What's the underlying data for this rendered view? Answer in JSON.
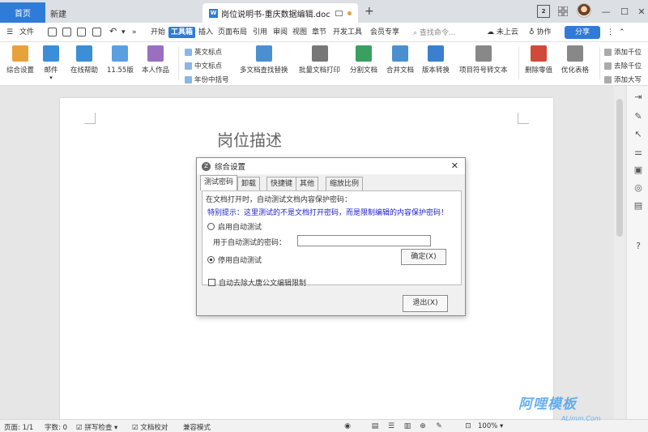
{
  "titlebar": {
    "tabs": [
      {
        "label": "首页"
      },
      {
        "label": "新建"
      },
      {
        "label": "岗位说明书-重庆数据编辑.doc"
      }
    ],
    "box_label": "2"
  },
  "menubar": {
    "file": "文件",
    "items": [
      "开始",
      "工具箱",
      "插入",
      "页面布局",
      "引用",
      "审阅",
      "视图",
      "章节",
      "开发工具",
      "会员专享"
    ],
    "search_placeholder": "查找命令...",
    "cloud": "未上云",
    "collab": "协作",
    "share": "分享"
  },
  "ribbon": {
    "buttons": [
      {
        "label": "综合设置",
        "color": "#e8a23a"
      },
      {
        "label": "邮件",
        "color": "#3a8fd8"
      },
      {
        "label": "在线帮助",
        "color": "#3a8fd8"
      },
      {
        "label": "11.55版",
        "color": "#5aa0e0"
      },
      {
        "label": "本人作品",
        "color": "#9a6fc0"
      }
    ],
    "small_left": [
      "英文标点",
      "中文标点",
      "年份中括号"
    ],
    "buttons2": [
      {
        "label": "多文档查找替换",
        "color": "#4a90d0"
      },
      {
        "label": "批量文档打印",
        "color": "#777777"
      },
      {
        "label": "分割文档",
        "color": "#3aa060"
      },
      {
        "label": "合并文档",
        "color": "#4a90d0"
      },
      {
        "label": "版本转换",
        "color": "#3a7fd0"
      },
      {
        "label": "项目符号转文本",
        "color": "#888888"
      },
      {
        "label": "删除零值",
        "color": "#d04a3a"
      },
      {
        "label": "优化表格",
        "color": "#888888"
      }
    ],
    "small_right": [
      "添加千位",
      "去除千位",
      "添加大写"
    ]
  },
  "document": {
    "heading": "岗位描述"
  },
  "dialog": {
    "title": "综合设置",
    "tabs": [
      "测试密码",
      "卸载",
      "快捷键",
      "其他",
      "缩放比例"
    ],
    "group_label": "在文档打开时，自动测试文档内容保护密码：",
    "warning": "特别提示：这里测试的不是文档打开密码，而是限制编辑的内容保护密码！",
    "radio_enable": "启用自动测试",
    "pwd_label": "用于自动测试的密码：",
    "pwd_value": "",
    "radio_disable": "停用自动测试",
    "confirm": "确定(X)",
    "checkbox_label": "自动去除大唐公文编辑限制",
    "exit": "退出(X)"
  },
  "statusbar": {
    "page": "页面: 1/1",
    "words": "字数: 0",
    "spell": "拼写检查",
    "proof": "文档校对",
    "compat": "兼容模式",
    "zoom": "100%"
  },
  "watermark": {
    "text": "阿哩模板",
    "sub": "ALimm.Com"
  },
  "colors": {
    "accent": "#2f7bd8",
    "warning_text": "#1a1ad0"
  }
}
